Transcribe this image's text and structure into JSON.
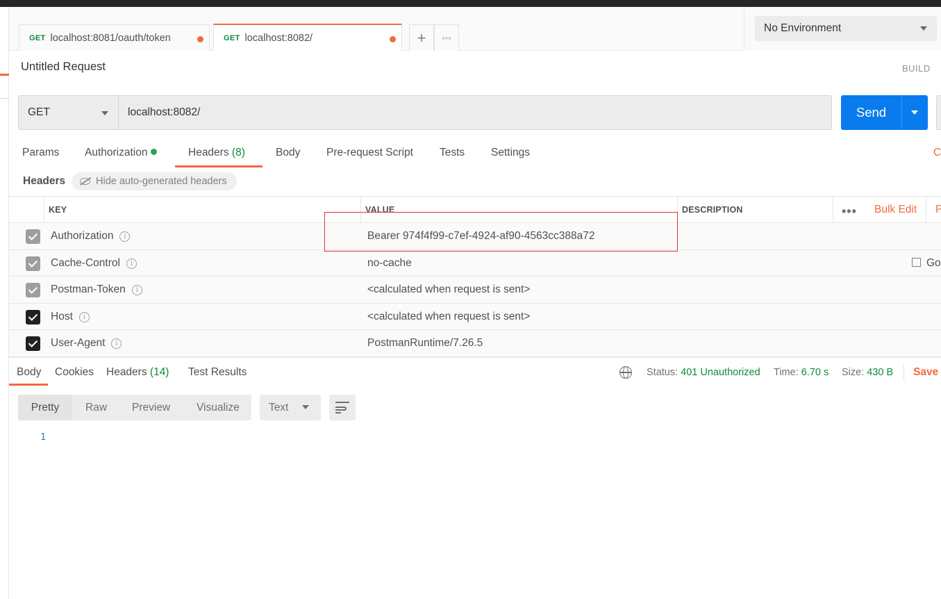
{
  "tabs": [
    {
      "method": "GET",
      "url": "localhost:8081/oauth/token"
    },
    {
      "method": "GET",
      "url": "localhost:8082/"
    }
  ],
  "new_tab_icon": "plus-icon",
  "more_tabs_icon": "ellipsis-icon",
  "environment": {
    "selected": "No Environment"
  },
  "request": {
    "title": "Untitled Request",
    "mode": "BUILD",
    "method": "GET",
    "url": "localhost:8082/",
    "send_label": "Send"
  },
  "request_tabs": {
    "params": "Params",
    "authorization": "Authorization",
    "headers": "Headers",
    "headers_count": "(8)",
    "body": "Body",
    "prerequest": "Pre-request Script",
    "tests": "Tests",
    "settings": "Settings",
    "cut_right": "C"
  },
  "headers_section": {
    "label": "Headers",
    "hide_auto": "Hide auto-generated headers",
    "columns": {
      "key": "KEY",
      "value": "VALUE",
      "description": "DESCRIPTION"
    },
    "more": "•••",
    "bulk_edit": "Bulk Edit",
    "presets_cut": "P",
    "goto_cut": "Go",
    "rows": [
      {
        "key": "Authorization",
        "value": "Bearer 974f4f99-c7ef-4924-af90-4563cc388a72",
        "checked": "auto"
      },
      {
        "key": "Cache-Control",
        "value": "no-cache",
        "checked": "auto"
      },
      {
        "key": "Postman-Token",
        "value": "<calculated when request is sent>",
        "checked": "auto"
      },
      {
        "key": "Host",
        "value": "<calculated when request is sent>",
        "checked": "user"
      },
      {
        "key": "User-Agent",
        "value": "PostmanRuntime/7.26.5",
        "checked": "user"
      }
    ]
  },
  "response": {
    "tabs": {
      "body": "Body",
      "cookies": "Cookies",
      "headers": "Headers",
      "headers_count": "(14)",
      "test_results": "Test Results"
    },
    "status_label": "Status:",
    "status_value": "401 Unauthorized",
    "time_label": "Time:",
    "time_value": "6.70 s",
    "size_label": "Size:",
    "size_value": "430 B",
    "save_label": "Save",
    "format_tabs": {
      "pretty": "Pretty",
      "raw": "Raw",
      "preview": "Preview",
      "visualize": "Visualize"
    },
    "type": "Text",
    "line_number": "1"
  },
  "colors": {
    "accent": "#f26b3a",
    "send": "#097bed",
    "status_ok": "#0b8a3c",
    "highlight": "#d8343b"
  }
}
